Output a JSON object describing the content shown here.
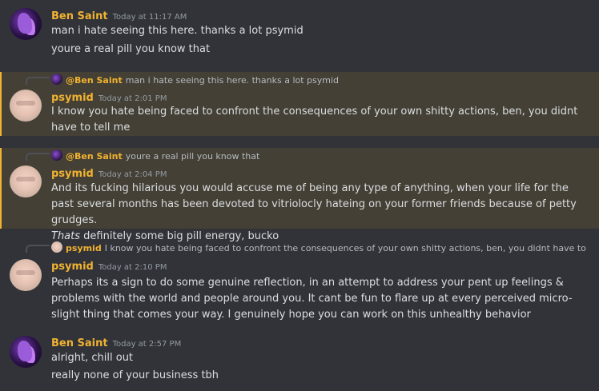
{
  "messages": {
    "m1": {
      "username": "Ben Saint",
      "timestamp": "Today at 11:17 AM",
      "lines": [
        "man i hate seeing this here. thanks a lot psymid",
        "youre a real pill you know that"
      ]
    },
    "m2": {
      "reply_name": "@Ben Saint",
      "reply_text": "man i hate seeing this here. thanks a lot psymid",
      "username": "psymid",
      "timestamp": "Today at 2:01 PM",
      "text": "I know you hate being faced to confront the consequences of your own shitty actions, ben, you didnt have to tell me"
    },
    "m3": {
      "reply_name": "@Ben Saint",
      "reply_text": "youre a real pill you know that",
      "username": "psymid",
      "timestamp": "Today at 2:04 PM",
      "text": "And its fucking hilarious you would accuse me of being any type of anything, when your life for the past several months has been devoted to vitriolocly hateing on your former friends because of petty grudges.",
      "italic": "Thats",
      "tail": " definitely some big pill energy, bucko"
    },
    "m4": {
      "reply_name": "psymid",
      "reply_text": "I know you hate being faced to confront the consequences of your own shitty actions, ben, you didnt have to tell me",
      "username": "psymid",
      "timestamp": "Today at 2:10 PM",
      "text": "Perhaps its a sign to do some genuine reflection, in an attempt to address your pent up feelings & problems with the world and people around you. It cant be fun to flare up at every perceived micro-slight thing that comes your way. I genuinely hope you can work on this unhealthy behavior"
    },
    "m5": {
      "username": "Ben Saint",
      "timestamp": "Today at 2:57 PM",
      "lines": [
        "alright, chill out",
        "really none of your business tbh"
      ]
    }
  },
  "colors": {
    "background": "#313338",
    "highlight": "#444035",
    "accent_name": "#f0b232"
  },
  "icons": {
    "avatar_ben": "purple-avatar",
    "avatar_psymid": "pale-face-avatar"
  }
}
